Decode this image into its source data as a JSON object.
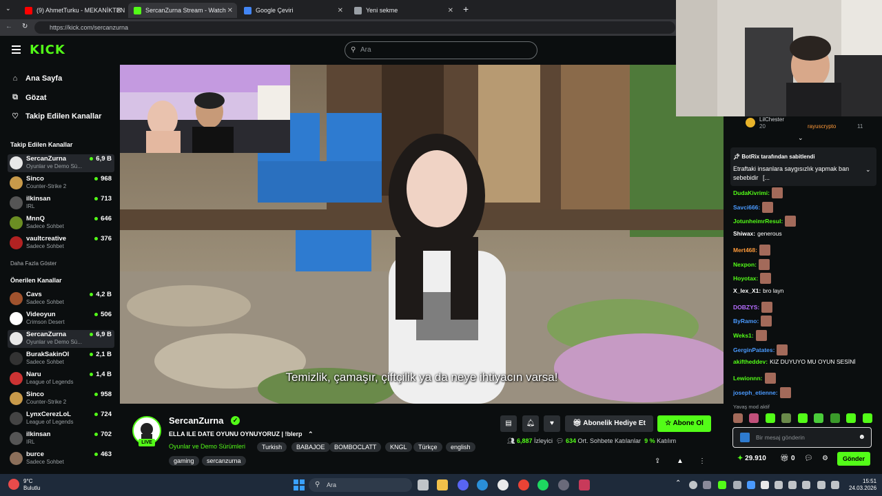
{
  "browser": {
    "tabs": [
      {
        "title": "(9) AhmetTurku - MEKANİKTEN Ç",
        "color": "#ff0000"
      },
      {
        "title": "SercanZurna Stream - Watch",
        "color": "#53fc18"
      },
      {
        "title": "Google Çeviri",
        "color": "#4285f4"
      },
      {
        "title": "Yeni sekme",
        "color": "#9aa0a6"
      }
    ],
    "url": "https://kick.com/sercanzurna"
  },
  "header": {
    "logo": "KICK",
    "search_placeholder": "Ara"
  },
  "sidebar": {
    "nav": [
      {
        "label": "Ana Sayfa",
        "icon": "home-icon",
        "glyph": "⌂"
      },
      {
        "label": "Gözat",
        "icon": "browse-icon",
        "glyph": "⧉"
      },
      {
        "label": "Takip Edilen Kanallar",
        "icon": "heart-icon",
        "glyph": "♡"
      }
    ],
    "followed_heading": "Takip Edilen Kanallar",
    "followed": [
      {
        "name": "SercanZurna",
        "category": "Oyunlar ve Demo Sü...",
        "viewers": "6,9 B",
        "color": "#e8e8e8",
        "selected": true
      },
      {
        "name": "Sinco",
        "category": "Counter-Strike 2",
        "viewers": "968",
        "color": "#c89a4a"
      },
      {
        "name": "ilkinsan",
        "category": "IRL",
        "viewers": "713",
        "color": "#555555"
      },
      {
        "name": "MnnQ",
        "category": "Sadece Sohbet",
        "viewers": "646",
        "color": "#6b8e23"
      },
      {
        "name": "vaultcreative",
        "category": "Sadece Sohbet",
        "viewers": "376",
        "color": "#b22222"
      }
    ],
    "show_more": "Daha Fazla Göster",
    "recommended_heading": "Önerilen Kanallar",
    "recommended": [
      {
        "name": "Cavs",
        "category": "Sadece Sohbet",
        "viewers": "4,2 B",
        "color": "#a0522d"
      },
      {
        "name": "Videoyun",
        "category": "Crimson Desert",
        "viewers": "506",
        "color": "#ffffff"
      },
      {
        "name": "SercanZurna",
        "category": "Oyunlar ve Demo Sü...",
        "viewers": "6,9 B",
        "color": "#e8e8e8",
        "selected": true
      },
      {
        "name": "BurakSakinOl",
        "category": "Sadece Sohbet",
        "viewers": "2,1 B",
        "color": "#333333"
      },
      {
        "name": "Naru",
        "category": "League of Legends",
        "viewers": "1,4 B",
        "color": "#cc3333"
      },
      {
        "name": "Sinco",
        "category": "Counter-Strike 2",
        "viewers": "958",
        "color": "#c89a4a"
      },
      {
        "name": "LynxCerezLoL",
        "category": "League of Legends",
        "viewers": "724",
        "color": "#444444"
      },
      {
        "name": "ilkinsan",
        "category": "IRL",
        "viewers": "702",
        "color": "#555555"
      },
      {
        "name": "burce",
        "category": "Sadece Sohbet",
        "viewers": "463",
        "color": "#8b6f5a"
      }
    ]
  },
  "video": {
    "subtitle": "Temizlik, çamaşır, çiftçilik ya da neye ihtiyacın varsa!"
  },
  "stream": {
    "name": "SercanZurna",
    "live": "LIVE",
    "title": "ELLA ILE DATE OYUNU OYNUYORUZ | !blerp",
    "category": "Oyunlar ve Demo Sürümleri",
    "tags": [
      "Turkish",
      "BABAJOE",
      "BOMBOCLATT",
      "KNGL",
      "Türkçe",
      "english",
      "gaming",
      "sercanzurna"
    ],
    "subscribe_label": "Abonelik Hediye Et",
    "follow_label": "Abone Ol",
    "viewers": "6,887",
    "viewers_label": "İzleyici",
    "chatters": "634",
    "chatters_label": "Ort. Sohbete Katılanlar",
    "participation": "9 %",
    "participation_label": "Katılım"
  },
  "chat": {
    "top_users": [
      {
        "name": "LilChester",
        "count": "20"
      },
      {
        "name": "rayuscrypto",
        "count": "11"
      }
    ],
    "pinned_header": "BotRix tarafından sabitlendi",
    "pinned_message": "Etraftaki insanlara saygısızlık yapmak ban sebebidir",
    "pinned_more": "[...",
    "messages": [
      {
        "user": "DudaKivrimi:",
        "text": "",
        "color": "#53fc18",
        "emote": true
      },
      {
        "user": "Savci666:",
        "text": "",
        "color": "#4a9aff",
        "emote": true
      },
      {
        "user": "JotunheimrResul:",
        "text": "",
        "color": "#53fc18",
        "emote": true
      },
      {
        "user": "Shiwax:",
        "text": "generous",
        "color": "#ffffff",
        "emote": false
      },
      {
        "user": "Mert468:",
        "text": "",
        "color": "#ff9a3a",
        "emote": true
      },
      {
        "user": "Nexpon:",
        "text": "",
        "color": "#53fc18",
        "emote": true
      },
      {
        "user": "Hoyotax:",
        "text": "",
        "color": "#53fc18",
        "emote": true
      },
      {
        "user": "X_lex_X1:",
        "text": "bro layn",
        "color": "#ffffff",
        "emote": false
      },
      {
        "user": "DOBZYS:",
        "text": "",
        "color": "#b66dff",
        "emote": true
      },
      {
        "user": "ByRamo:",
        "text": "",
        "color": "#4a9aff",
        "emote": true
      },
      {
        "user": "Weks1:",
        "text": "",
        "color": "#53fc18",
        "emote": true
      },
      {
        "user": "GerginPatates:",
        "text": "",
        "color": "#4a9aff",
        "emote": true
      },
      {
        "user": "akiftheddev:",
        "text": "KIZ DUYUYO MU OYUN SESİNİ",
        "color": "#53fc18",
        "emote": false
      },
      {
        "user": "Lewionnn:",
        "text": "",
        "color": "#53fc18",
        "emote": true
      },
      {
        "user": "joseph_etienne:",
        "text": "",
        "color": "#4a9aff",
        "emote": true
      }
    ],
    "slow_mode": "Yavaş mod aktif",
    "input_placeholder": "Bir mesaj gönderin",
    "points": "29.910",
    "count": "0",
    "send_label": "Gönder"
  },
  "taskbar": {
    "weather_temp": "9°C",
    "weather_desc": "Bulutlu",
    "search_label": "Ara",
    "time": "15:51",
    "date": "24.03.2026"
  }
}
